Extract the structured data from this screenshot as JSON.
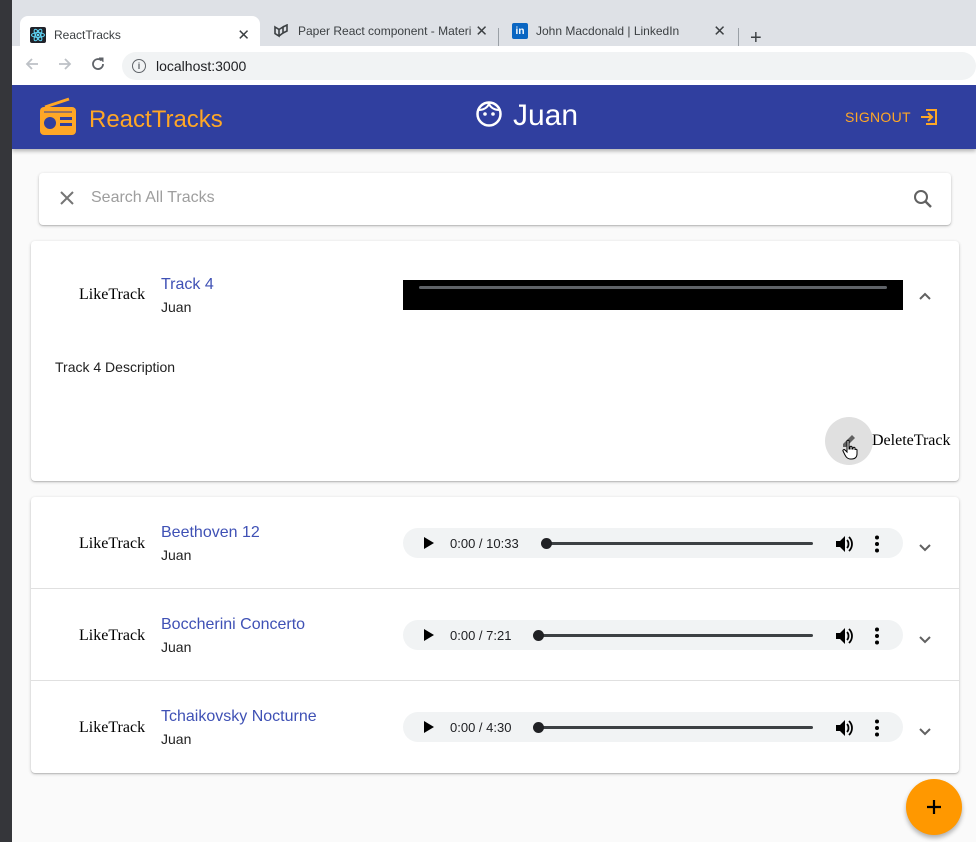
{
  "browser": {
    "tabs": [
      {
        "title": "ReactTracks",
        "favicon": "react-icon"
      },
      {
        "title": "Paper React component - Materi",
        "favicon": "material-ui-icon"
      },
      {
        "title": "John Macdonald | LinkedIn",
        "favicon": "linkedin-icon"
      }
    ],
    "new_tab": "+",
    "close": "✕",
    "url": "localhost:3000"
  },
  "appbar": {
    "brand": "ReactTracks",
    "user": "Juan",
    "signout": "SIGNOUT"
  },
  "search": {
    "placeholder": "Search All Tracks"
  },
  "expanded_track": {
    "like_label": "LikeTrack",
    "title": "Track 4",
    "user": "Juan",
    "description": "Track 4 Description",
    "delete_label": "DeleteTrack"
  },
  "tracks": [
    {
      "like_label": "LikeTrack",
      "title": "Beethoven 12",
      "user": "Juan",
      "time": "0:00 / 10:33"
    },
    {
      "like_label": "LikeTrack",
      "title": "Boccherini Concerto",
      "user": "Juan",
      "time": "0:00 / 7:21"
    },
    {
      "like_label": "LikeTrack",
      "title": "Tchaikovsky Nocturne",
      "user": "Juan",
      "time": "0:00 / 4:30"
    }
  ],
  "colors": {
    "appbar": "#303f9f",
    "accent": "#ffa726",
    "link": "#3f51b5",
    "fab": "#ff9800"
  }
}
